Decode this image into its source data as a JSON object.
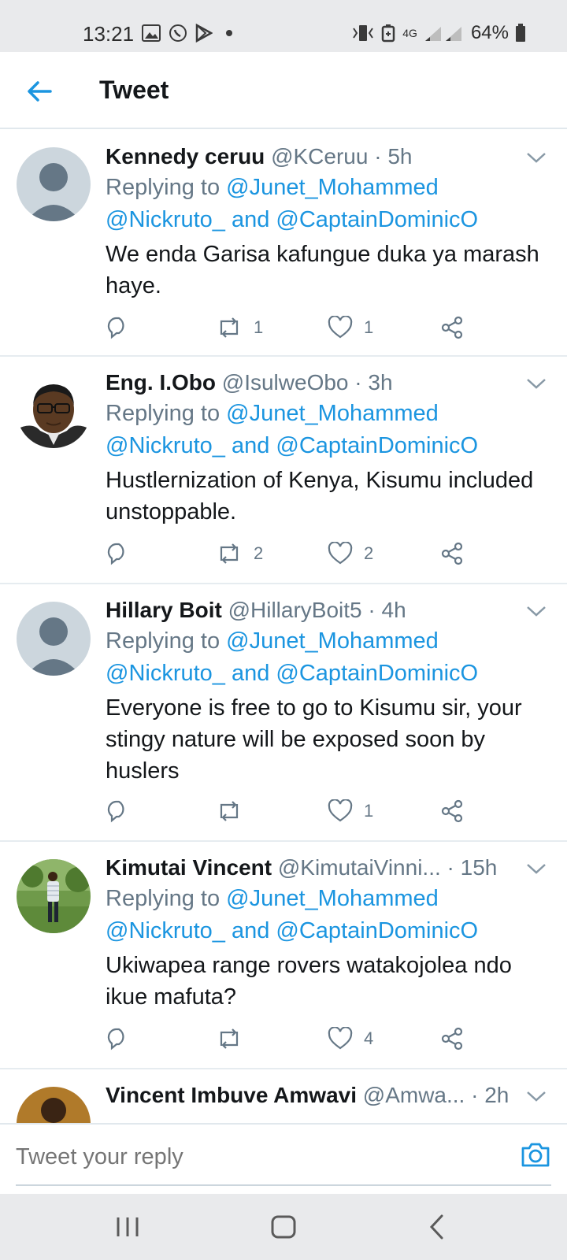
{
  "status_bar": {
    "time": "13:21",
    "network": "4G",
    "battery": "64%",
    "left_icons": [
      "image-icon",
      "whatsapp-icon",
      "play-store-icon",
      "dot-icon"
    ],
    "right_icons": [
      "vibrate-icon",
      "battery-saver-icon",
      "signal-icon",
      "battery-icon"
    ]
  },
  "header": {
    "title": "Tweet",
    "back_icon": "arrow-left-icon"
  },
  "colors": {
    "accent": "#1b95e0",
    "text": "#14171a",
    "secondary_text": "#657786",
    "divider": "#e6ecf0",
    "system_bar": "#e9eaec"
  },
  "tweets": [
    {
      "name": "Kennedy ceruu",
      "handle": "@KCeruu",
      "time": "· 5h",
      "replying_prefix": "Replying to ",
      "replying_first": "@Junet_Mohammed",
      "replying_second": "@Nickruto_ and @CaptainDominicO",
      "text": "We enda Garisa kafungue duka ya marash haye.",
      "retweets": "1",
      "likes": "1",
      "avatar": "default-avatar"
    },
    {
      "name": "Eng. I.Obo",
      "handle": "@IsulweObo",
      "time": "· 3h",
      "replying_prefix": "Replying to ",
      "replying_first": "@Junet_Mohammed",
      "replying_second": "@Nickruto_ and @CaptainDominicO",
      "text": "Hustlernization of Kenya, Kisumu included unstoppable.",
      "retweets": "2",
      "likes": "2",
      "avatar": "photo-avatar-man-glasses"
    },
    {
      "name": "Hillary Boit",
      "handle": "@HillaryBoit5",
      "time": "· 4h",
      "replying_prefix": "Replying to ",
      "replying_first": "@Junet_Mohammed",
      "replying_second": "@Nickruto_ and @CaptainDominicO",
      "text": "Everyone is free to go to Kisumu sir, your stingy nature will be exposed soon by huslers",
      "retweets": "",
      "likes": "1",
      "avatar": "default-avatar"
    },
    {
      "name": "Kimutai Vincent",
      "handle": "@KimutaiVinni...",
      "time": "· 15h",
      "replying_prefix": "Replying to ",
      "replying_first": "@Junet_Mohammed",
      "replying_second": "@Nickruto_ and @CaptainDominicO",
      "text": "Ukiwapea range rovers watakojolea ndo ikue mafuta?",
      "retweets": "",
      "likes": "4",
      "avatar": "photo-avatar-man-outdoors"
    },
    {
      "name": "Vincent Imbuve Amwavi",
      "handle": "@Amwa...",
      "time": "· 2h",
      "avatar": "photo-avatar-partial"
    }
  ],
  "reply_bar": {
    "placeholder": "Tweet your reply",
    "camera_icon": "camera-icon"
  },
  "nav_bar": {
    "icons": [
      "recent-apps-icon",
      "home-icon",
      "back-icon"
    ]
  }
}
